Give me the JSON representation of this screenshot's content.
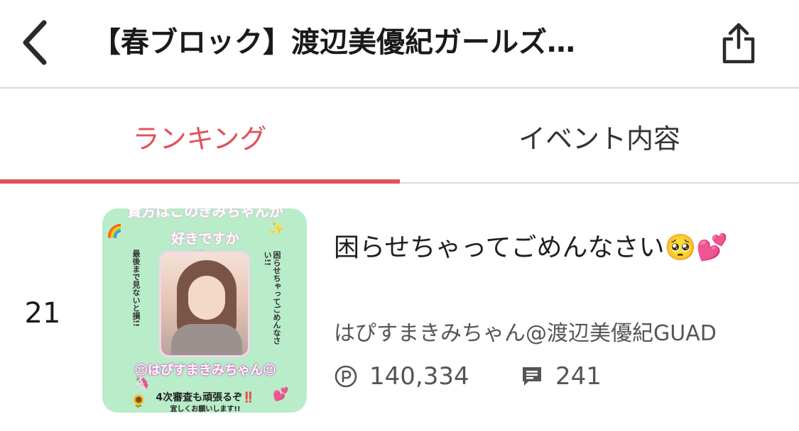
{
  "header": {
    "title": "【春ブロック】渡辺美優紀ガールズ…",
    "back_icon": "chevron-left-icon",
    "share_icon": "share-icon"
  },
  "tabs": [
    {
      "label": "ランキング",
      "active": true
    },
    {
      "label": "イベント内容",
      "active": false
    }
  ],
  "colors": {
    "accent": "#e0525c",
    "divider": "#d9d9d9",
    "thumb_bg": "#b9ecc9"
  },
  "entry": {
    "rank": "21",
    "title": "困らせちゃってごめんなさい🥺💕",
    "user": "はぴすまきみちゃん@渡辺美優紀GUAD",
    "points": "140,334",
    "comments": "241",
    "points_icon": "points-icon",
    "comments_icon": "comment-icon",
    "thumbnail": {
      "top_text": "貴方はこのきみちゃんが",
      "question": "好きですか❤️？",
      "left_vertical": "最後まで見ないと損!!",
      "right_vertical": "困らせちゃってごめんなさい!!",
      "name": "☺はぴすまきみちゃん☺",
      "bottom_line1": "4次審査も頑張るぞ‼️",
      "bottom_line2": "宜しくお願いします!!"
    }
  }
}
